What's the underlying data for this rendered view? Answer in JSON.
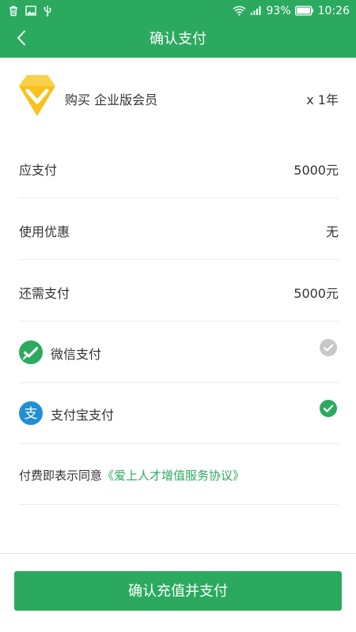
{
  "status_bar": {
    "battery": "93%",
    "time": "10:26",
    "icons": [
      "trash-icon",
      "image-icon",
      "usb-icon",
      "wifi-icon",
      "signal-icon",
      "battery-icon"
    ]
  },
  "nav": {
    "title": "确认支付",
    "back_icon": "chevron-left-icon"
  },
  "product": {
    "icon": "vip-diamond-badge-icon",
    "name": "购买 企业版会员",
    "quantity": "x 1年"
  },
  "summary": [
    {
      "label": "应支付",
      "value": "5000元"
    },
    {
      "label": "使用优惠",
      "value": "无"
    },
    {
      "label": "还需支付",
      "value": "5000元"
    }
  ],
  "payment_methods": [
    {
      "label": "微信支付",
      "icon": "wechat-pay-icon",
      "selected": false
    },
    {
      "label": "支付宝支付",
      "icon": "alipay-icon",
      "selected": true
    }
  ],
  "agreement": {
    "prefix": "付费即表示同意",
    "link": "《爱上人才增值服务协议》"
  },
  "footer": {
    "confirm_label": "确认充值并支付"
  },
  "colors": {
    "brand_green": "#2baa5f",
    "unselected_gray": "#c8c8c8",
    "alipay_blue": "#1f8fd6",
    "badge_yellow": "#f7c21a"
  }
}
